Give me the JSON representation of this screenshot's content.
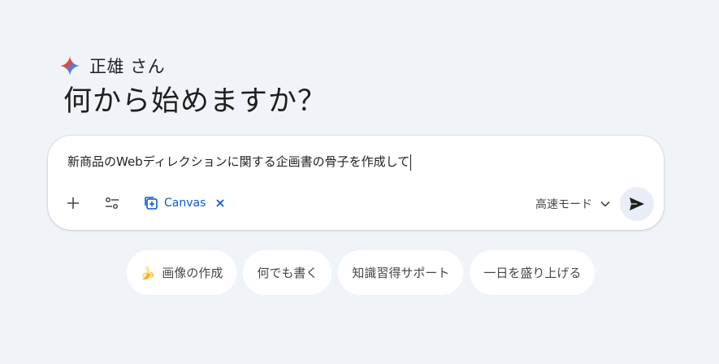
{
  "greeting": {
    "name": "正雄 さん",
    "icon": "gemini-spark-icon"
  },
  "headline": "何から始めますか？",
  "prompt": {
    "value": "新商品のWebディレクションに関する企画書の骨子を作成して",
    "add_icon": "plus-icon",
    "tools_icon": "tools-sliders-icon"
  },
  "canvas_chip": {
    "label": "Canvas",
    "icon": "canvas-add-icon",
    "close_icon": "close-icon"
  },
  "mode": {
    "label": "高速モード",
    "icon": "chevron-down-icon"
  },
  "send": {
    "icon": "send-icon"
  },
  "suggestions": [
    {
      "label": "画像の作成",
      "emoji": "🍌"
    },
    {
      "label": "何でも書く"
    },
    {
      "label": "知識習得サポート"
    },
    {
      "label": "一日を盛り上げる"
    }
  ],
  "colors": {
    "background": "#f0f4f9",
    "accent": "#0b57d0",
    "card": "#ffffff"
  }
}
